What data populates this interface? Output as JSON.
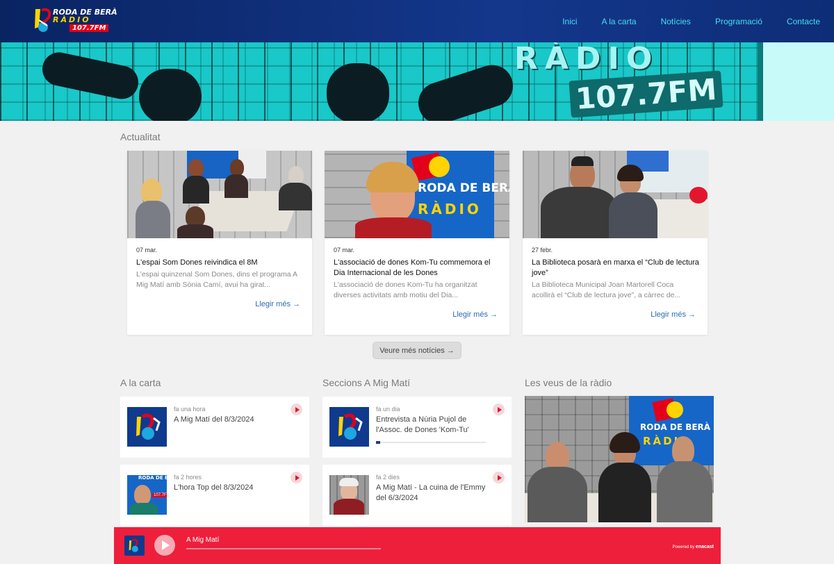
{
  "brand": {
    "logo_line1": "RODA DE BERÀ",
    "logo_line2": "RÀDIO",
    "logo_line3": "107.7FM"
  },
  "nav": {
    "items": [
      {
        "label": "Inici"
      },
      {
        "label": "A la carta"
      },
      {
        "label": "Notícies"
      },
      {
        "label": "Programació"
      },
      {
        "label": "Contacte"
      }
    ]
  },
  "hero": {
    "sign_word": "RÀDIO",
    "sign_freq": "107.7FM"
  },
  "news": {
    "title": "Actualitat",
    "cards": [
      {
        "date": "07 mar.",
        "title": "L'espai Som Dones reivindica el 8M",
        "excerpt": "L'espai quinzenal Som Dones, dins el programa A Mig Matí amb Sònia Camí, avui ha girat...",
        "more": "Llegir més →"
      },
      {
        "date": "07 mar.",
        "title": "L'associació de dones Kom-Tu commemora el Dia Internacional de les Dones",
        "excerpt": "L'associació de dones Kom-Tu ha organitzat diverses activitats amb motiu del Dia...",
        "more": "Llegir més →"
      },
      {
        "date": "27 febr.",
        "title": "La Biblioteca posarà en marxa el “Club de lectura jove”",
        "excerpt": "La Biblioteca Municipal Joan Martorell Coca acollirà el “Club de lectura jove”, a càrrec de...",
        "more": "Llegir més →"
      }
    ],
    "more_button": "Veure més notícies →"
  },
  "alacarta": {
    "title": "A la carta",
    "items": [
      {
        "ago": "fa una hora",
        "title": "A Mig Matí del 8/3/2024"
      },
      {
        "ago": "fa 2 hores",
        "title": "L'hora Top del 8/3/2024"
      }
    ]
  },
  "seccions": {
    "title": "Seccions A Mig Matí",
    "items": [
      {
        "ago": "fa un dia",
        "title": "Entrevista a Núria Pujol de l'Assoc. de Dones 'Kom-Tu'",
        "progress": 0.04
      },
      {
        "ago": "fa 2 dies",
        "title": "A Mig Matí - La cuina de l'Emmy del 6/3/2024"
      }
    ]
  },
  "veus": {
    "title": "Les veus de la ràdio"
  },
  "player": {
    "title": "A Mig Matí",
    "powered_prefix": "Powered by",
    "powered_brand": "enacast"
  },
  "colors": {
    "header": "#0a2462",
    "nav_link": "#3fe0f0",
    "hero": "#1ad3d3",
    "player": "#ee1f3b",
    "link": "#2b6bb3"
  }
}
